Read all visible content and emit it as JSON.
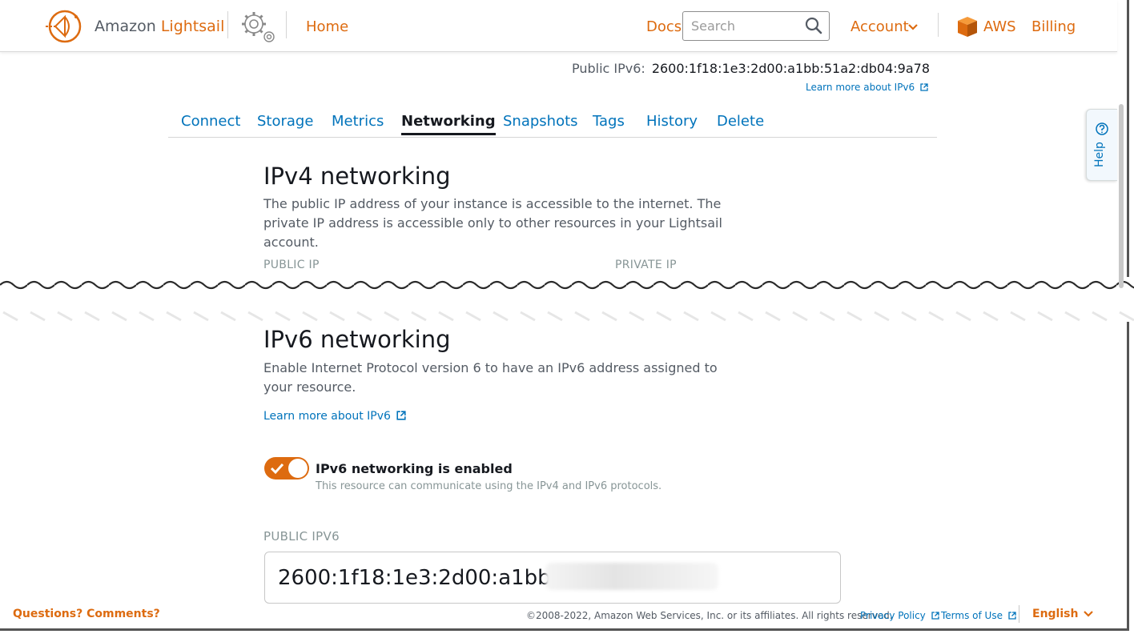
{
  "header": {
    "brand_prefix": "Amazon",
    "brand_name": "Lightsail",
    "home": "Home",
    "docs": "Docs",
    "search_placeholder": "Search",
    "account": "Account",
    "aws": "AWS",
    "billing": "Billing"
  },
  "instance": {
    "public_ipv6_label": "Public IPv6:",
    "public_ipv6_value": "2600:1f18:1e3:2d00:a1bb:51a2:db04:9a78",
    "learn_more": "Learn more about IPv6"
  },
  "tabs": [
    "Connect",
    "Storage",
    "Metrics",
    "Networking",
    "Snapshots",
    "Tags",
    "History",
    "Delete"
  ],
  "active_tab": "Networking",
  "ipv4": {
    "title": "IPv4 networking",
    "description": "The public IP address of your instance is accessible to the internet. The private IP address is accessible only to other resources in your Lightsail account.",
    "public_ip_label": "PUBLIC IP",
    "private_ip_label": "PRIVATE IP"
  },
  "ipv6": {
    "title": "IPv6 networking",
    "description": "Enable Internet Protocol version 6 to have an IPv6 address assigned to your resource.",
    "learn_more": "Learn more about IPv6",
    "toggle_enabled": true,
    "toggle_title": "IPv6 networking is enabled",
    "toggle_subtitle": "This resource can communicate using the IPv4 and IPv6 protocols.",
    "public_ipv6_label": "PUBLIC IPV6",
    "public_ipv6_value": "2600:1f18:1e3:2d00:a1bb:"
  },
  "help": {
    "label": "Help"
  },
  "footer": {
    "questions": "Questions? Comments?",
    "copyright": "©2008-2022, Amazon Web Services, Inc. or its affiliates. All rights reserved.",
    "privacy": "Privacy Policy",
    "terms": "Terms of Use",
    "language": "English"
  },
  "colors": {
    "accent": "#dd6b10",
    "link": "#0073bb",
    "text": "#16191f",
    "muted": "#545b64"
  }
}
